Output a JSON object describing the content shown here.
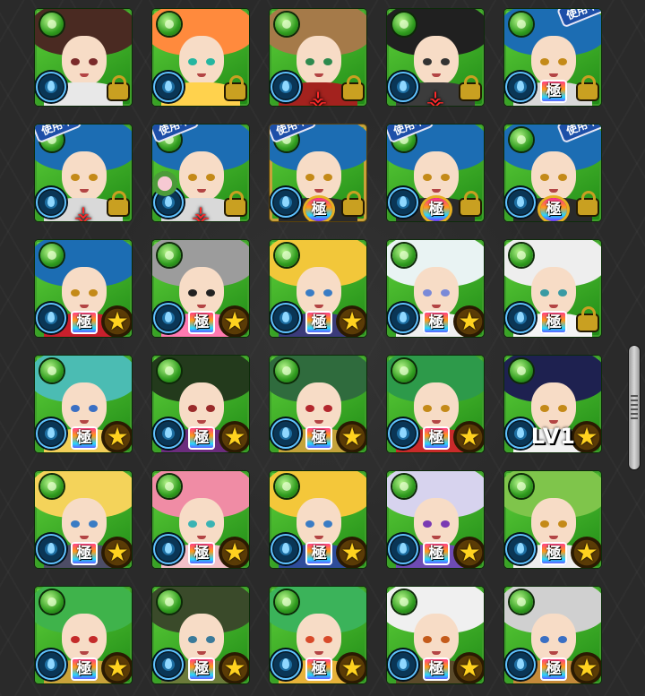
{
  "in_use_label": "使用中",
  "goku_label": "極",
  "colors": {
    "frame": "#3fa02b",
    "water": "#1d6fa3",
    "star": "#ffd21f",
    "in_use": "#1d4fa8"
  },
  "cards": [
    {
      "id": 1,
      "hair": "#4a2a22",
      "cloth": "#e8e8e8",
      "eyes": "#7a2a2a",
      "lock": true,
      "goku": false
    },
    {
      "id": 2,
      "hair": "#ff8a3d",
      "cloth": "#ffd24d",
      "eyes": "#25b6a0",
      "lock": true,
      "goku": false
    },
    {
      "id": 3,
      "hair": "#a57a49",
      "cloth": "#a3221e",
      "eyes": "#2e8a4e",
      "lock": true,
      "goku": false,
      "mark": true
    },
    {
      "id": 4,
      "hair": "#202020",
      "cloth": "#3c3c3c",
      "eyes": "#333",
      "lock": true,
      "goku": false,
      "mark": true
    },
    {
      "id": 5,
      "hair": "#1c6db3",
      "cloth": "#d9d9d9",
      "eyes": "#c48a18",
      "lock": true,
      "goku": true,
      "inuse": true,
      "col5": true
    },
    {
      "id": 6,
      "hair": "#1c6db3",
      "cloth": "#d9d9d9",
      "eyes": "#c48a18",
      "lock": true,
      "goku": false,
      "inuse": true,
      "mark": true
    },
    {
      "id": 7,
      "hair": "#1c6db3",
      "cloth": "#d9d9d9",
      "eyes": "#c48a18",
      "lock": true,
      "goku": false,
      "inuse": true,
      "mark": true,
      "mini": true
    },
    {
      "id": 8,
      "hair": "#1c6db3",
      "cloth": "#2a2a2a",
      "eyes": "#c48a18",
      "lock": true,
      "goku": true,
      "circled": true,
      "inuse": true,
      "gold": true
    },
    {
      "id": 9,
      "hair": "#1c6db3",
      "cloth": "#2a2a2a",
      "eyes": "#c48a18",
      "lock": true,
      "goku": true,
      "circled": true,
      "inuse": true
    },
    {
      "id": 10,
      "hair": "#1c6db3",
      "cloth": "#2a2a2a",
      "eyes": "#c48a18",
      "lock": true,
      "goku": true,
      "circled": true,
      "inuse": true,
      "col5": true
    },
    {
      "id": 11,
      "hair": "#1c6db3",
      "cloth": "#c81f2c",
      "eyes": "#c48a18",
      "star": true,
      "goku": true
    },
    {
      "id": 12,
      "hair": "#9c9c9c",
      "cloth": "#ff7ab0",
      "eyes": "#222",
      "star": true,
      "goku": true
    },
    {
      "id": 13,
      "hair": "#f2c73a",
      "cloth": "#3b3b7a",
      "eyes": "#3a7cc4",
      "star": true,
      "goku": true
    },
    {
      "id": 14,
      "hair": "#e9f3f3",
      "cloth": "#f0f0f0",
      "eyes": "#7a8ad8",
      "star": true,
      "goku": true
    },
    {
      "id": 15,
      "hair": "#eeeeee",
      "cloth": "#f4f4f4",
      "eyes": "#3a9aa3",
      "lock": true,
      "goku": true
    },
    {
      "id": 16,
      "hair": "#4bbcb3",
      "cloth": "#f2cf59",
      "eyes": "#3a6fc4",
      "star": true,
      "goku": true
    },
    {
      "id": 17,
      "hair": "#233a1c",
      "cloth": "#6b2c7d",
      "eyes": "#9a2a2a",
      "star": true,
      "goku": true
    },
    {
      "id": 18,
      "hair": "#2f6b3d",
      "cloth": "#c4a33a",
      "eyes": "#b3272d",
      "star": true,
      "goku": true
    },
    {
      "id": 19,
      "hair": "#2d9a4a",
      "cloth": "#c92a2a",
      "eyes": "#c48a18",
      "star": true,
      "goku": true
    },
    {
      "id": 20,
      "hair": "#1e2150",
      "cloth": "#f2f2f2",
      "eyes": "#c48a18",
      "star": true,
      "goku": false,
      "level": "LV1"
    },
    {
      "id": 21,
      "hair": "#f4d35a",
      "cloth": "#4d4d66",
      "eyes": "#3a7cc4",
      "star": true,
      "goku": true
    },
    {
      "id": 22,
      "hair": "#f08ca5",
      "cloth": "#f3c0c8",
      "eyes": "#3ab3b3",
      "star": true,
      "goku": true
    },
    {
      "id": 23,
      "hair": "#f4c73a",
      "cloth": "#2e4c9a",
      "eyes": "#3a7cc4",
      "star": true,
      "goku": true
    },
    {
      "id": 24,
      "hair": "#d7d3ee",
      "cloth": "#6e4bb3",
      "eyes": "#7a3ab3",
      "star": true,
      "goku": true
    },
    {
      "id": 25,
      "hair": "#7fc54b",
      "cloth": "#eeeeee",
      "eyes": "#c48a18",
      "star": true,
      "goku": true
    },
    {
      "id": 26,
      "hair": "#3fb34b",
      "cloth": "#c9a33a",
      "eyes": "#c42a2a",
      "star": true,
      "goku": true
    },
    {
      "id": 27,
      "hair": "#3a4a2a",
      "cloth": "#6b7a3a",
      "eyes": "#3a7a9a",
      "star": true,
      "goku": true
    },
    {
      "id": 28,
      "hair": "#3bb35a",
      "cloth": "#e6b23a",
      "eyes": "#d84a2a",
      "star": true,
      "goku": true
    },
    {
      "id": 29,
      "hair": "#f0f0f0",
      "cloth": "#5a4a2a",
      "eyes": "#c45a1a",
      "star": true,
      "goku": true
    },
    {
      "id": 30,
      "hair": "#d0d0d0",
      "cloth": "#c48a3a",
      "eyes": "#3a6fc4",
      "star": true,
      "goku": true
    }
  ]
}
